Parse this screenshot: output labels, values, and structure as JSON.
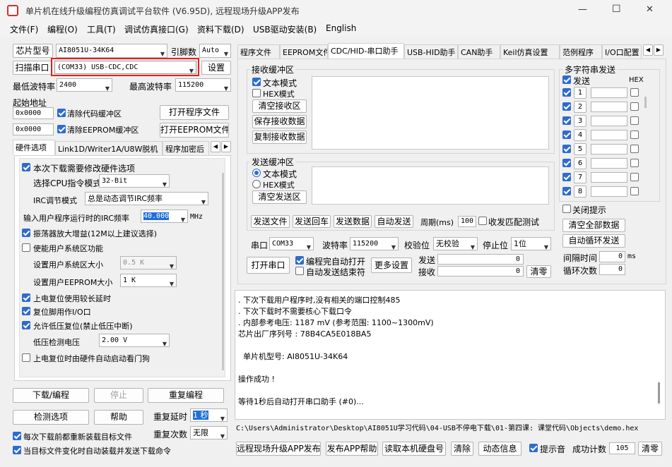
{
  "window": {
    "title": "单片机在线升级编程仿真调试平台软件 (V6.95D), 远程现场升级APP发布",
    "controls": {
      "minimize": "—",
      "maximize": "☐",
      "close": "✕"
    }
  },
  "menu": [
    "文件(F)",
    "编程(O)",
    "工具(T)",
    "调试仿真接口(G)",
    "资料下载(D)",
    "USB驱动安装(B)",
    "English"
  ],
  "left": {
    "chip_label": "芯片型号",
    "chip_value": "AI8051U-34K64",
    "pins_label": "引脚数",
    "pins_value": "Auto",
    "scan_label": "扫描串口",
    "port_value": "(COM33) USB-CDC,CDC",
    "settings_btn": "设置",
    "min_baud_label": "最低波特率",
    "min_baud_value": "2400",
    "max_baud_label": "最高波特率",
    "max_baud_value": "115200",
    "start_addr_label": "起始地址",
    "addr1_value": "0x0000",
    "clear_code_label": "清除代码缓冲区",
    "open_prog_btn": "打开程序文件",
    "addr2_value": "0x0000",
    "clear_eeprom_label": "清除EEPROM缓冲区",
    "open_eeprom_btn": "打开EEPROM文件",
    "tabs": [
      "硬件选项",
      "Link1D/Writer1A/U8W脱机",
      "程序加密后"
    ],
    "hw": {
      "modify_hw": "本次下载需要修改硬件选项",
      "cpu_mode_label": "选择CPU指令模式",
      "cpu_mode_value": "32-Bit",
      "irc_mode_label": "IRC调节模式",
      "irc_mode_value": "总是动态调节IRC频率",
      "irc_freq_label": "输入用户程序运行时的IRC频率",
      "irc_freq_value": "40.000",
      "irc_freq_unit": "MHz",
      "osc_gain": "振荡器放大增益(12M以上建议选择)",
      "user_sys_area": "使能用户系统区功能",
      "sys_area_size_label": "设置用户系统区大小",
      "sys_area_size_value": "0.5 K",
      "eeprom_size_label": "设置用户EEPROM大小",
      "eeprom_size_value": "1   K",
      "por_delay": "上电复位使用较长延时",
      "reset_io": "复位脚用作I/O口",
      "lvr": "允许低压复位(禁止低压中断)",
      "lv_detect_label": "低压检测电压",
      "lv_detect_value": "2.00 V",
      "wdt": "上电复位时由硬件自动启动看门狗"
    },
    "download_btn": "下载/编程",
    "stop_btn": "停止",
    "repeat_prog_btn": "重复编程",
    "detect_btn": "检测选项",
    "help_btn": "帮助",
    "repeat_delay_label": "重复延时",
    "repeat_delay_value": "1 秒",
    "repeat_count_label": "重复次数",
    "repeat_count_value": "无限",
    "reload_each": "每次下载前都重新装载目标文件",
    "auto_send": "当目标文件变化时自动装载并发送下载命令"
  },
  "right": {
    "tabs": [
      "程序文件",
      "EEPROM文件",
      "CDC/HID-串口助手",
      "USB-HID助手",
      "CAN助手",
      "Keil仿真设置",
      "范例程序",
      "I/O口配置"
    ],
    "recv_group": "接收缓冲区",
    "recv_text_mode": "文本模式",
    "recv_hex_mode": "HEX模式",
    "clear_recv": "清空接收区",
    "save_recv": "保存接收数据",
    "copy_recv": "复制接收数据",
    "send_group": "发送缓冲区",
    "send_text_mode": "文本模式",
    "send_hex_mode": "HEX模式",
    "clear_send": "清空发送区",
    "send_file": "发送文件",
    "send_return": "发送回车",
    "send_data": "发送数据",
    "auto_send": "自动发送",
    "period_label": "周期(ms)",
    "period_value": "100",
    "match_test": "收发匹配测试",
    "multi_group": "多字符串发送",
    "multi_send_label": "发送",
    "multi_hex_label": "HEX",
    "multi_rows": [
      "1",
      "2",
      "3",
      "4",
      "5",
      "6",
      "7",
      "8"
    ],
    "close_tip": "关闭提示",
    "clear_all": "清空全部数据",
    "auto_loop": "自动循环发送",
    "interval_label": "间隔时间",
    "interval_value": "0",
    "interval_unit": "ms",
    "loop_count_label": "循环次数",
    "loop_count_value": "0",
    "serial_label": "串口",
    "serial_value": "COM33",
    "baud_label": "波特率",
    "baud_value": "115200",
    "parity_label": "校验位",
    "parity_value": "无校验",
    "stop_label": "停止位",
    "stop_value": "1位",
    "open_port": "打开串口",
    "auto_open_after": "编程完自动打开",
    "auto_stop_send": "自动发送结束符",
    "more_settings": "更多设置",
    "tx_label": "发送",
    "tx_value": "0",
    "rx_label": "接收",
    "rx_value": "0",
    "clear_count": "清零"
  },
  "log": [
    ". 下次下载用户程序时,没有相关的端口控制485",
    ". 下次下载时不需要核心下载口令",
    ". 内部参考电压: 1187 mV (参考范围: 1100~1300mV)",
    "芯片出厂序列号 : 78B4CA5E018BA5",
    "",
    "  单片机型号: AI8051U-34K64",
    "",
    "操作成功 !",
    "",
    "等待1秒后自动打开串口助手 (#0)..."
  ],
  "path": "C:\\Users\\Administrator\\Desktop\\AI8051U学习代码\\04-USB不停电下载\\01-第四课: 课堂代码\\Objects\\demo.hex",
  "bottom": {
    "remote_publish": "远程现场升级APP发布",
    "publish_help": "发布APP帮助",
    "read_hdd": "读取本机硬盘号",
    "clear": "清除",
    "dynamic_info": "动态信息",
    "beep": "提示音",
    "success_label": "成功计数",
    "success_value": "105",
    "clear_count": "清零"
  },
  "colors": {
    "highlight_border": "#e02020",
    "accent": "#2d6bd1",
    "selection": "#1e6fd9"
  }
}
